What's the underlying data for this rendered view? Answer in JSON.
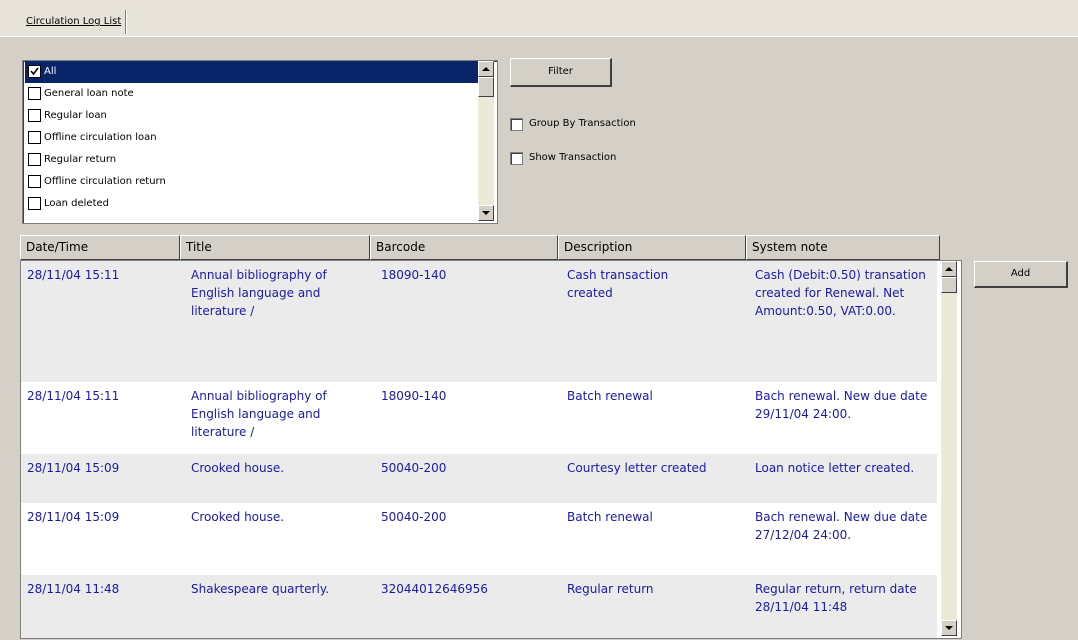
{
  "tab": {
    "label": "Circulation Log List"
  },
  "filter_list": {
    "items": [
      {
        "label": "All",
        "checked": true,
        "selected": true
      },
      {
        "label": "General loan note",
        "checked": false,
        "selected": false
      },
      {
        "label": "Regular loan",
        "checked": false,
        "selected": false
      },
      {
        "label": "Offline circulation loan",
        "checked": false,
        "selected": false
      },
      {
        "label": "Regular return",
        "checked": false,
        "selected": false
      },
      {
        "label": "Offline circulation return",
        "checked": false,
        "selected": false
      },
      {
        "label": "Loan deleted",
        "checked": false,
        "selected": false
      }
    ]
  },
  "buttons": {
    "filter_label": "Filter",
    "add_label": "Add"
  },
  "options": {
    "group_by_transaction": {
      "label": "Group By Transaction",
      "checked": false
    },
    "show_transaction": {
      "label": "Show Transaction",
      "checked": false
    }
  },
  "table": {
    "columns": [
      "Date/Time",
      "Title",
      "Barcode",
      "Description",
      "System note"
    ],
    "rows": [
      {
        "datetime": "28/11/04 15:11",
        "title": "Annual bibliography of English language and literature /",
        "barcode": "18090-140",
        "description": "Cash transaction created",
        "system_note": "Cash (Debit:0.50) transation created for Renewal. Net Amount:0.50, VAT:0.00."
      },
      {
        "datetime": "28/11/04 15:11",
        "title": "Annual bibliography of English language and literature /",
        "barcode": "18090-140",
        "description": "Batch renewal",
        "system_note": "Bach renewal. New due date 29/11/04 24:00."
      },
      {
        "datetime": "28/11/04 15:09",
        "title": "Crooked house.",
        "barcode": "50040-200",
        "description": "Courtesy letter created",
        "system_note": "Loan notice letter created."
      },
      {
        "datetime": "28/11/04 15:09",
        "title": "Crooked house.",
        "barcode": "50040-200",
        "description": "Batch renewal",
        "system_note": "Bach renewal. New due date 27/12/04 24:00."
      },
      {
        "datetime": "28/11/04 11:48",
        "title": "Shakespeare quarterly.",
        "barcode": "32044012646956",
        "description": "Regular return",
        "system_note": "Regular return, return date 28/11/04 11:48"
      }
    ]
  },
  "colors": {
    "selection": "#0a246a",
    "grid_text": "#1a1aa6",
    "panel": "#d4d0c8",
    "row_shade": "#ebebeb"
  }
}
